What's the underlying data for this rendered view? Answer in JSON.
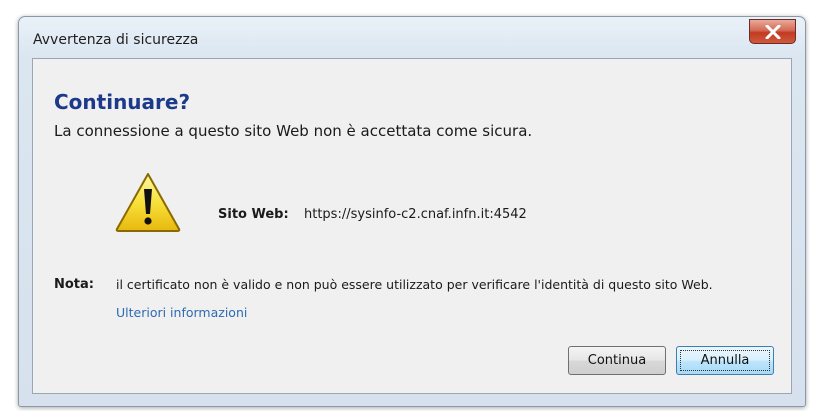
{
  "window": {
    "title": "Avvertenza di sicurezza"
  },
  "dialog": {
    "heading": "Continuare?",
    "message": "La connessione a questo sito Web non è accettata come sicura.",
    "site_label": "Sito Web:",
    "site_url": "https://sysinfo-c2.cnaf.infn.it:4542",
    "note_label": "Nota:",
    "note_text": "il certificato non è valido e non può essere utilizzato per verificare l'identità di questo sito Web.",
    "more_info_link": "Ulteriori informazioni"
  },
  "buttons": {
    "continue": "Continua",
    "cancel": "Annulla"
  },
  "icons": {
    "close": "close-icon",
    "warning": "warning-icon"
  },
  "colors": {
    "heading": "#1d3a8a",
    "link": "#2d6bb3",
    "close_button": "#c23a22",
    "warning_fill": "#f7e13a"
  }
}
